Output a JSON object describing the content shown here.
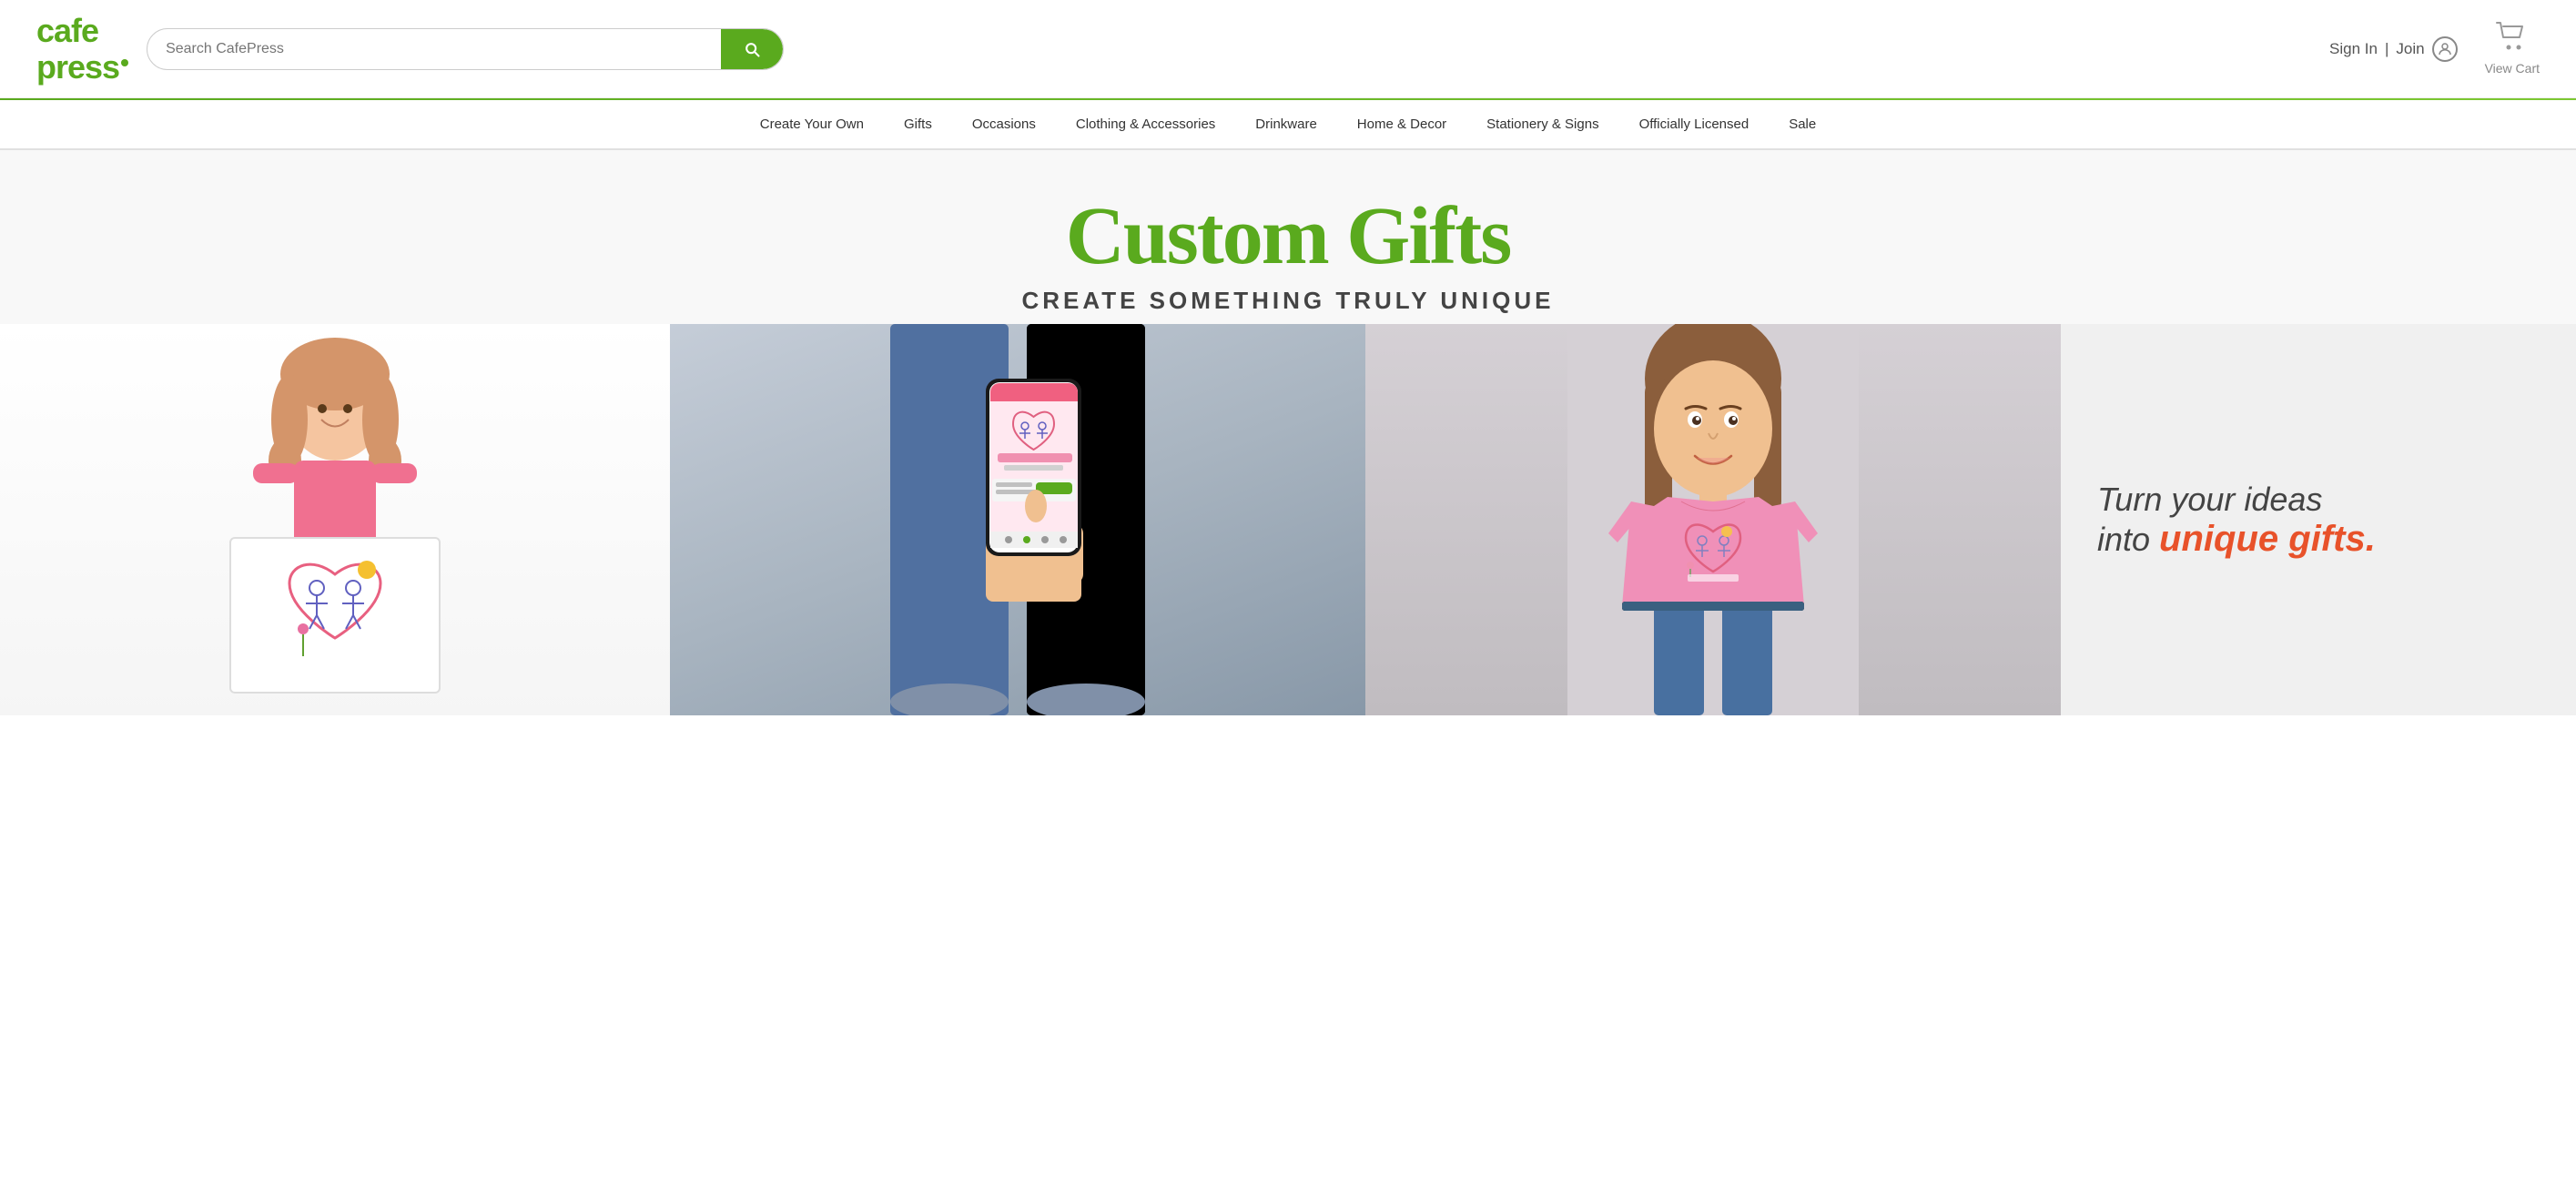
{
  "header": {
    "logo": {
      "line1": "cafe",
      "line2": "press"
    },
    "search": {
      "placeholder": "Search CafePress",
      "button_label": "Search"
    },
    "auth": {
      "sign_in_label": "Sign In",
      "separator": "|",
      "join_label": "Join"
    },
    "cart": {
      "label": "View Cart"
    }
  },
  "nav": {
    "items": [
      {
        "label": "Create Your Own",
        "id": "create-your-own"
      },
      {
        "label": "Gifts",
        "id": "gifts"
      },
      {
        "label": "Occasions",
        "id": "occasions"
      },
      {
        "label": "Clothing & Accessories",
        "id": "clothing"
      },
      {
        "label": "Drinkware",
        "id": "drinkware"
      },
      {
        "label": "Home & Decor",
        "id": "home-decor"
      },
      {
        "label": "Stationery & Signs",
        "id": "stationery"
      },
      {
        "label": "Officially Licensed",
        "id": "officially-licensed"
      },
      {
        "label": "Sale",
        "id": "sale"
      }
    ]
  },
  "hero": {
    "main_title": "Custom Gifts",
    "subtitle": "CREATE SOMETHING TRULY UNIQUE",
    "tagline_line1": "Turn your ideas",
    "tagline_line2": "into",
    "tagline_emphasis": "unique gifts."
  },
  "colors": {
    "brand_green": "#5aaa1e",
    "accent_orange": "#e8522a",
    "text_dark": "#444444",
    "text_gray": "#888888"
  }
}
